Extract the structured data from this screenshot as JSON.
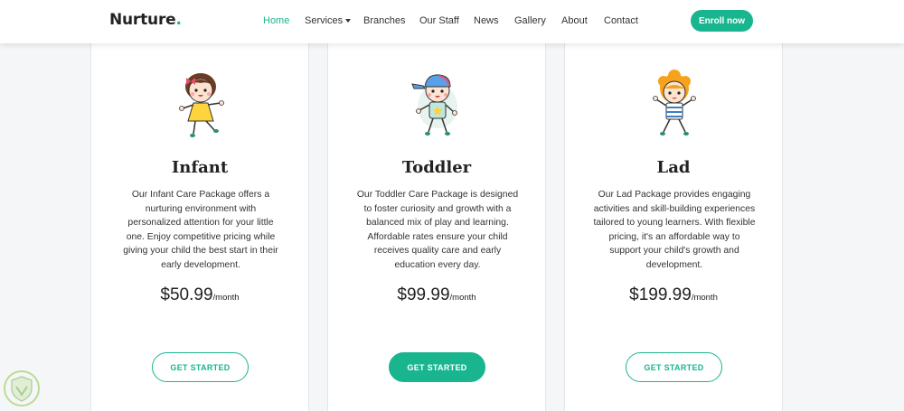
{
  "brand": {
    "name": "Nurture",
    "dot": "."
  },
  "nav": {
    "items": [
      {
        "label": "Home"
      },
      {
        "label": "Services"
      },
      {
        "label": "Branches"
      },
      {
        "label": "Our Staff"
      },
      {
        "label": "News"
      },
      {
        "label": "Gallery"
      },
      {
        "label": "About"
      },
      {
        "label": "Contact"
      }
    ],
    "enroll_label": "Enroll now"
  },
  "colors": {
    "accent": "#19b58f",
    "text": "#333333",
    "background": "#f5f6f8"
  },
  "packages": [
    {
      "title": "Infant",
      "icon": "girl-illustration",
      "description": "Our Infant Care Package offers a nurturing environment with personalized attention for your little one. Enjoy competitive pricing while giving your child the best start in their early development.",
      "price": "$50.99",
      "period": "/month",
      "cta_label": "GET STARTED",
      "cta_style": "outline"
    },
    {
      "title": "Toddler",
      "icon": "boy-cap-illustration",
      "description": "Our Toddler Care Package is designed to foster curiosity and growth with a balanced mix of play and learning. Affordable rates ensure your child receives quality care and early education every day.",
      "price": "$99.99",
      "period": "/month",
      "cta_label": "GET STARTED",
      "cta_style": "filled"
    },
    {
      "title": "Lad",
      "icon": "boy-curly-hair-illustration",
      "description": "Our Lad Package provides engaging activities and skill-building experiences tailored to young learners. With flexible pricing, it's an affordable way to support your child's growth and development.",
      "price": "$199.99",
      "period": "/month",
      "cta_label": "GET STARTED",
      "cta_style": "outline"
    }
  ]
}
